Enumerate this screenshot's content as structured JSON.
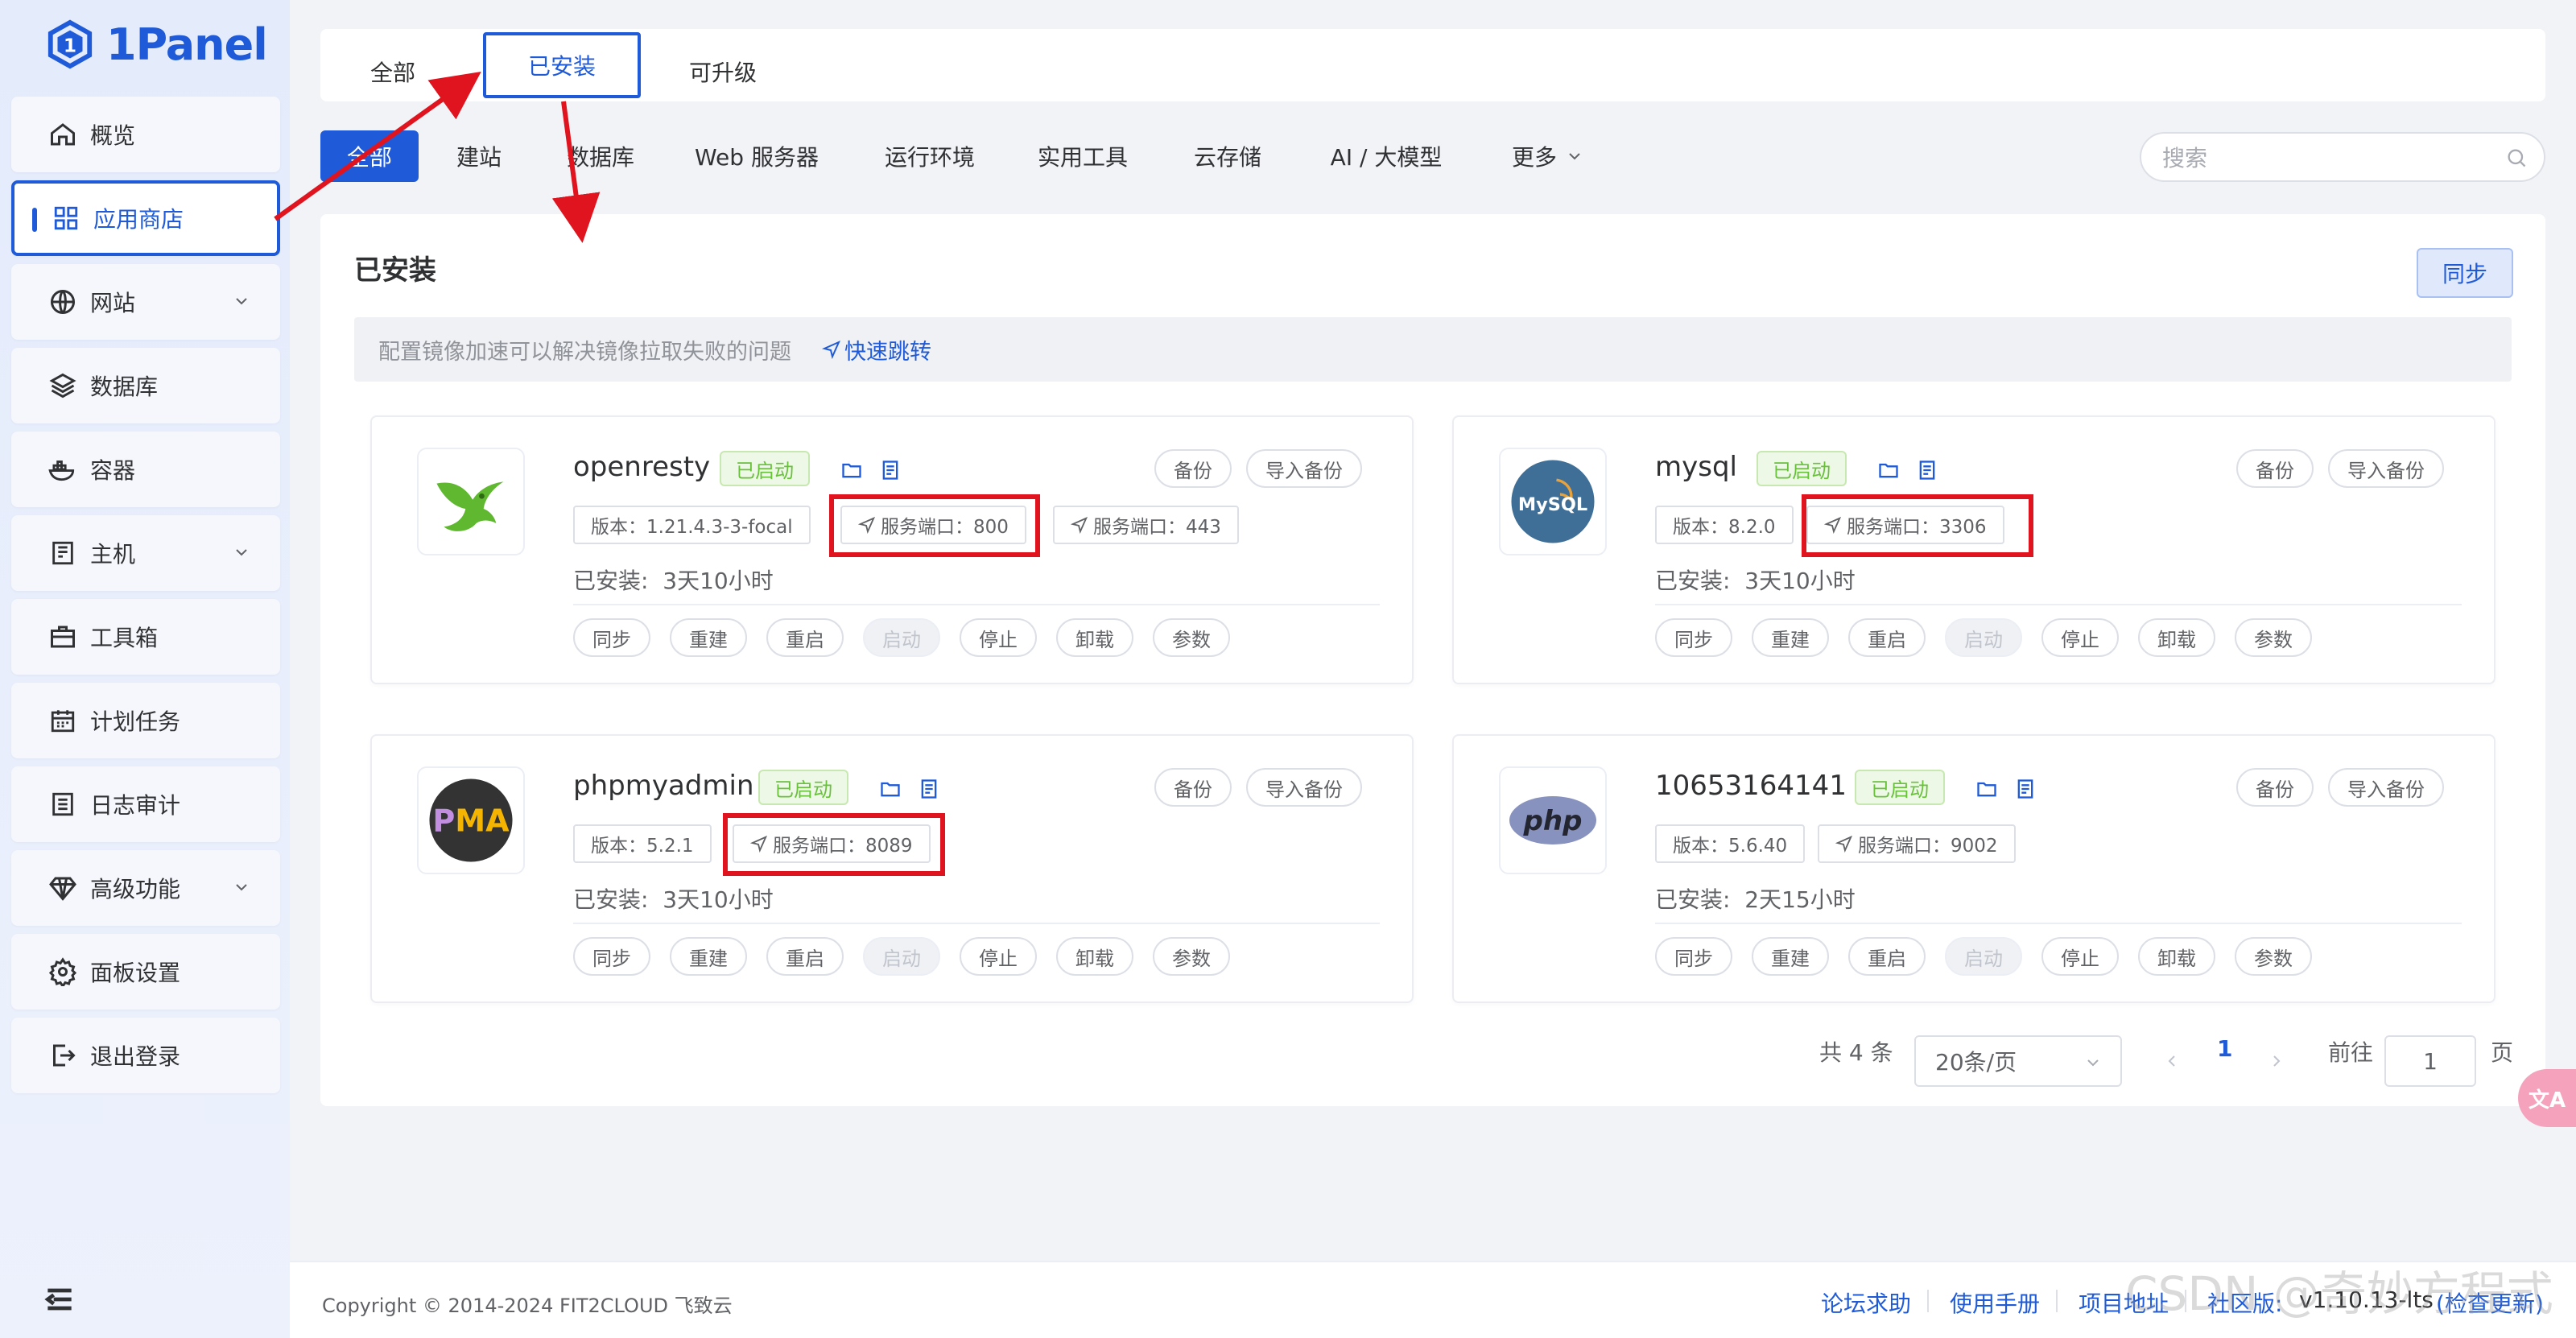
{
  "brand": {
    "name": "1Panel",
    "accent": "#1f5bd8"
  },
  "sidebar": {
    "items": [
      {
        "label": "概览",
        "icon": "home-icon"
      },
      {
        "label": "应用商店",
        "icon": "apps-grid-icon",
        "active": true
      },
      {
        "label": "网站",
        "icon": "globe-icon",
        "expandable": true
      },
      {
        "label": "数据库",
        "icon": "layers-icon"
      },
      {
        "label": "容器",
        "icon": "docker-icon"
      },
      {
        "label": "主机",
        "icon": "host-icon",
        "expandable": true
      },
      {
        "label": "工具箱",
        "icon": "toolbox-icon"
      },
      {
        "label": "计划任务",
        "icon": "calendar-icon"
      },
      {
        "label": "日志审计",
        "icon": "log-icon"
      },
      {
        "label": "高级功能",
        "icon": "diamond-icon",
        "expandable": true
      },
      {
        "label": "面板设置",
        "icon": "gear-icon"
      },
      {
        "label": "退出登录",
        "icon": "logout-icon"
      }
    ]
  },
  "top_tabs": {
    "all": "全部",
    "installed": "已安装",
    "upgradable": "可升级"
  },
  "categories": {
    "all": "全部",
    "site": "建站",
    "database": "数据库",
    "web_server": "Web 服务器",
    "runtime": "运行环境",
    "tools": "实用工具",
    "storage": "云存储",
    "ai": "AI / 大模型",
    "more": "更多"
  },
  "search": {
    "placeholder": "搜索"
  },
  "panel": {
    "title": "已安装",
    "sync_label": "同步",
    "notice": "配置镜像加速可以解决镜像拉取失败的问题",
    "notice_link": "快速跳转"
  },
  "card_labels": {
    "status": "已启动",
    "backup": "备份",
    "import_backup": "导入备份",
    "installed_prefix": "已安装:",
    "actions": [
      "同步",
      "重建",
      "重启",
      "启动",
      "停止",
      "卸载",
      "参数"
    ]
  },
  "apps": [
    {
      "name": "openresty",
      "version": "版本：1.21.4.3-3-focal",
      "ports": [
        "服务端口：800",
        "服务端口：443"
      ],
      "installed": "3天10小时"
    },
    {
      "name": "mysql",
      "version": "版本：8.2.0",
      "ports": [
        "服务端口：3306"
      ],
      "installed": "3天10小时"
    },
    {
      "name": "phpmyadmin",
      "version": "版本：5.2.1",
      "ports": [
        "服务端口：8089"
      ],
      "installed": "3天10小时"
    },
    {
      "name": "10653164141",
      "version": "版本：5.6.40",
      "ports": [
        "服务端口：9002"
      ],
      "installed": "2天15小时"
    }
  ],
  "pagination": {
    "total": "共 4 条",
    "page_size": "20条/页",
    "current": "1",
    "goto_prefix": "前往",
    "goto_value": "1",
    "goto_suffix": "页"
  },
  "footer": {
    "copyright": "Copyright © 2014-2024 FIT2CLOUD 飞致云",
    "links": [
      "论坛求助",
      "使用手册",
      "项目地址"
    ],
    "community": "社区版:",
    "version": "v1.10.13-lts",
    "check_update": "检查更新"
  },
  "watermark": "CSDN @奇妙方程式",
  "float_label": "文A",
  "colors": {
    "highlight_red": "#e0141e",
    "success": "#67c23a"
  }
}
